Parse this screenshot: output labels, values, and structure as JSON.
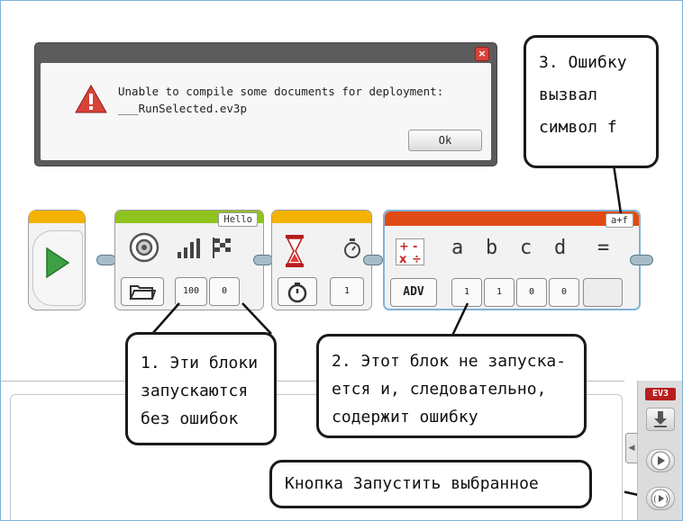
{
  "dialog": {
    "message_line1": "Unable to compile some documents for deployment:",
    "message_line2": "___RunSelected.ev3p",
    "ok_label": "Ok",
    "close_glyph": "×"
  },
  "blocks": {
    "sound": {
      "tag": "Hello",
      "volume": "100",
      "play_type": "0"
    },
    "wait": {
      "time": "1"
    },
    "math": {
      "tag": "a+f",
      "mode_label": "ADV",
      "variables": [
        "a",
        "b",
        "c",
        "d"
      ],
      "values": [
        "1",
        "1",
        "0",
        "0"
      ],
      "equals_glyph": "="
    }
  },
  "ev3_panel": {
    "logo": "EV3",
    "icons": [
      "download-icon",
      "play-icon",
      "run-selected-icon"
    ]
  },
  "callouts": {
    "c1": [
      "1. Эти блоки",
      "запускаются",
      "без ошибок"
    ],
    "c2": [
      "2. Этот блок не запуска-",
      "ется и, следовательно,",
      "содержит ошибку"
    ],
    "c3": [
      "3. Ошибку",
      "вызвал",
      "символ f"
    ],
    "c4": "Кнопка Запустить выбранное"
  },
  "colors": {
    "start_bar": "#f4b300",
    "sound_bar": "#8fc31f",
    "wait_bar": "#f4b300",
    "math_bar": "#e04b14",
    "error_icon": "#d8423a",
    "frame_border": "#7fb2d8"
  }
}
